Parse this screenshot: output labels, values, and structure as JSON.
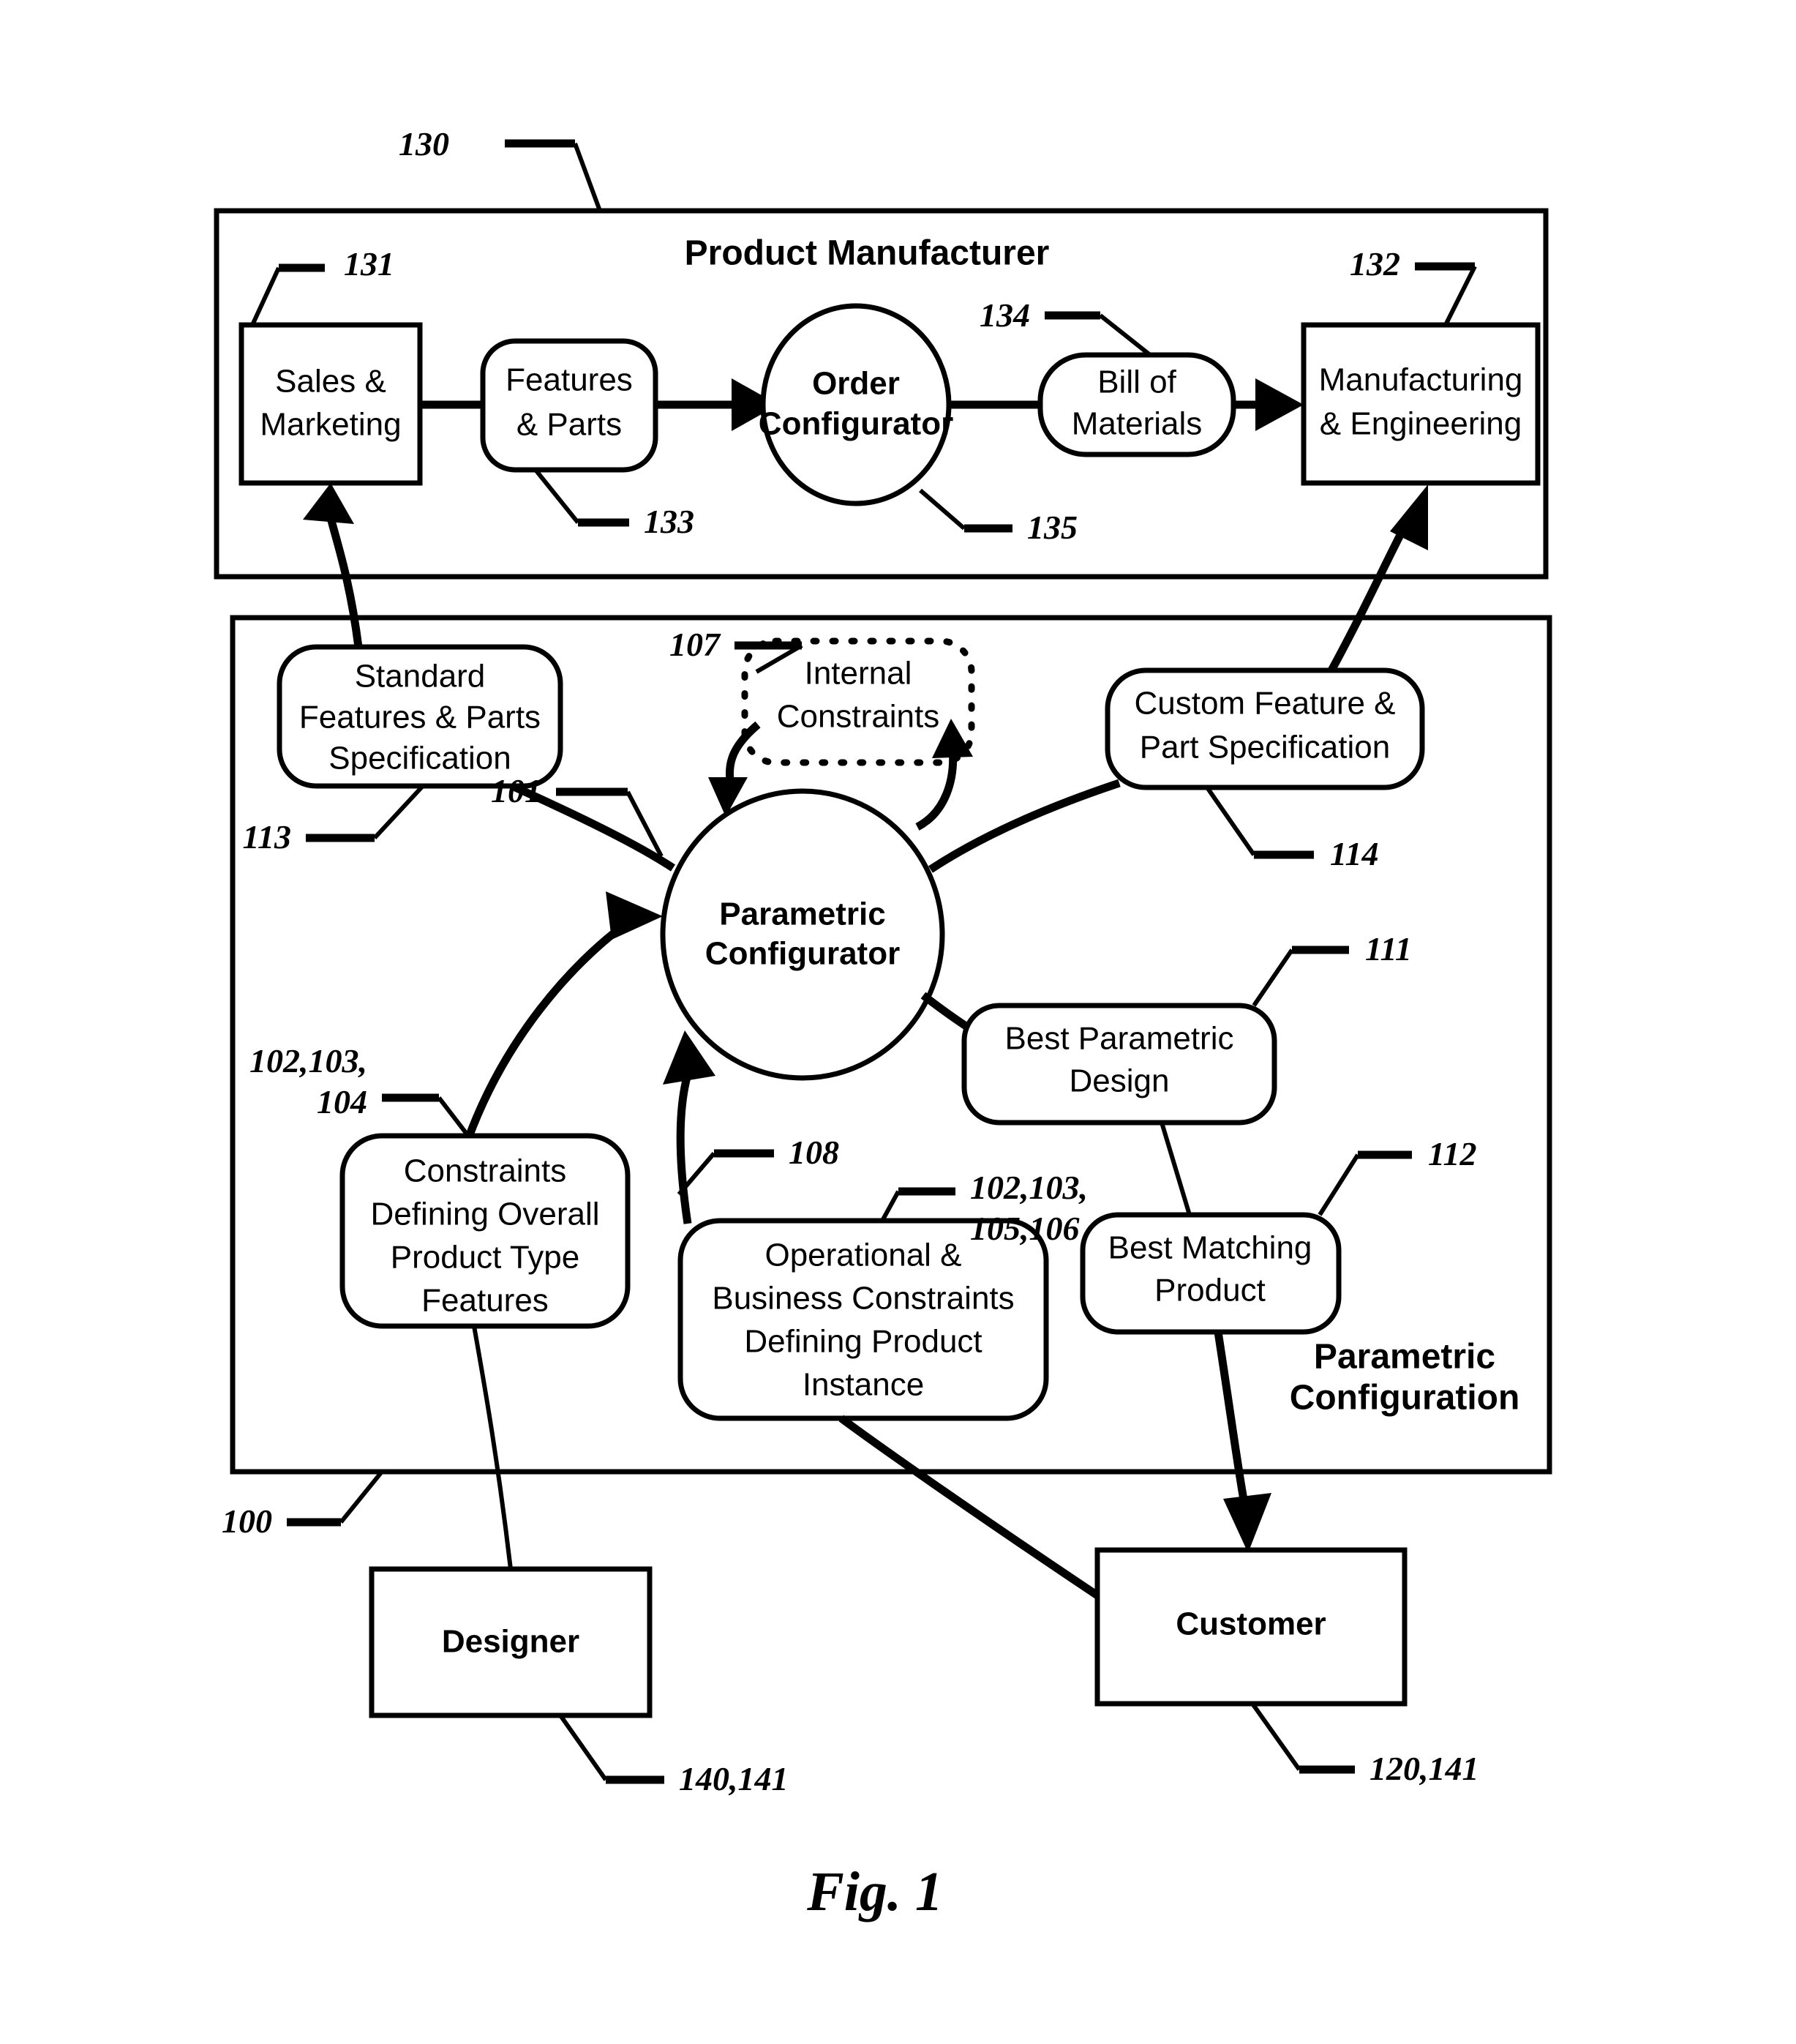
{
  "figure": {
    "caption": "Fig. 1",
    "frames": {
      "top": {
        "title": "Product Manufacturer",
        "ref": "130"
      },
      "bottom": {
        "title_line1": "Parametric",
        "title_line2": "Configuration",
        "ref": "100"
      }
    },
    "nodes": [
      {
        "id": "sales-marketing",
        "line1": "Sales &",
        "line2": "Marketing",
        "ref": "131",
        "shape": "rect"
      },
      {
        "id": "features-parts",
        "line1": "Features",
        "line2": "& Parts",
        "ref": "133",
        "shape": "rounded"
      },
      {
        "id": "order-configurator",
        "line1": "Order",
        "line2": "Configurator",
        "ref": "135",
        "shape": "ellipse"
      },
      {
        "id": "bill-of-materials",
        "line1": "Bill of",
        "line2": "Materials",
        "ref": "134",
        "shape": "rounded"
      },
      {
        "id": "manufacturing-engineering",
        "line1": "Manufacturing",
        "line2": "& Engineering",
        "ref": "132",
        "shape": "rect"
      },
      {
        "id": "standard-features-parts-specification",
        "line1": "Standard",
        "line2": "Features & Parts",
        "line3": "Specification",
        "ref": "113",
        "shape": "rounded"
      },
      {
        "id": "internal-constraints",
        "line1": "Internal",
        "line2": "Constraints",
        "ref": "107",
        "shape": "dashed"
      },
      {
        "id": "custom-feature-part-specification",
        "line1": "Custom Feature &",
        "line2": "Part Specification",
        "ref": "114",
        "shape": "rounded"
      },
      {
        "id": "parametric-configurator",
        "line1": "Parametric",
        "line2": "Configurator",
        "ref": "101",
        "shape": "ellipse"
      },
      {
        "id": "best-parametric-design",
        "line1": "Best Parametric",
        "line2": "Design",
        "ref": "111",
        "shape": "rounded"
      },
      {
        "id": "best-matching-product",
        "line1": "Best Matching",
        "line2": "Product",
        "ref": "112",
        "shape": "rounded"
      },
      {
        "id": "constraints-defining-overall-product-type-features",
        "line1": "Constraints",
        "line2": "Defining Overall",
        "line3": "Product Type",
        "line4": "Features",
        "ref_line1": "102,103,",
        "ref_line2": "104",
        "shape": "rounded"
      },
      {
        "id": "operational-business-constraints",
        "line1": "Operational &",
        "line2": "Business Constraints",
        "line3": "Defining Product",
        "line4": "Instance",
        "ref_line1": "102,103,",
        "ref_line2": "105,106",
        "ref_arrow": "108",
        "shape": "rounded"
      },
      {
        "id": "designer",
        "line1": "Designer",
        "ref": "140,141",
        "shape": "rect"
      },
      {
        "id": "customer",
        "line1": "Customer",
        "ref": "120,141",
        "shape": "rect"
      }
    ]
  }
}
